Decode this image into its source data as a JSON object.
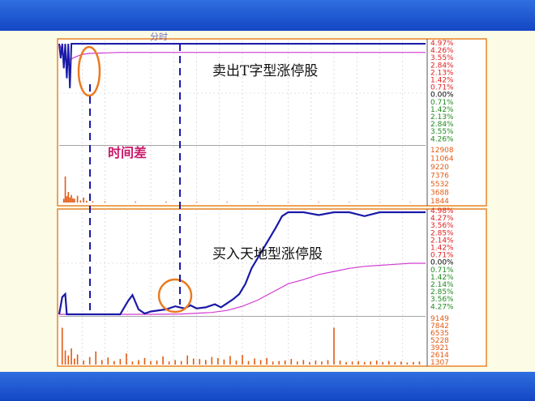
{
  "colors": {
    "price_line": "#1a1aa8",
    "avg_line": "#d23bd2",
    "volume_bar": "#e05a14",
    "up_label": "#e02020",
    "down_label": "#208a20",
    "zero_label": "#000000",
    "volume_label": "#e05a14",
    "frame": "#e8842a",
    "marker": "#ea7a20",
    "dashed": "#1a1aa8",
    "annotation": "#c8186a"
  },
  "chart_data": [
    {
      "type": "line",
      "panel": "top",
      "title": "卖出T字型涨停股",
      "header_text": "分时",
      "annotation": "时间差",
      "y_labels": [
        "4.97%",
        "4.26%",
        "3.55%",
        "2.84%",
        "2.13%",
        "1.42%",
        "0.71%",
        "0.00%",
        "0.71%",
        "1.42%",
        "2.13%",
        "2.84%",
        "3.55%",
        "4.26%"
      ],
      "y_label_signs": [
        "up",
        "up",
        "up",
        "up",
        "up",
        "up",
        "up",
        "zero",
        "down",
        "down",
        "down",
        "down",
        "down",
        "down"
      ],
      "ylim": [
        -4.97,
        4.97
      ],
      "xlim": [
        0,
        240
      ],
      "price": {
        "x": [
          0,
          1,
          2,
          3,
          4,
          5,
          6,
          7,
          8,
          9,
          10,
          11,
          12,
          15,
          20,
          40,
          60,
          90,
          120,
          150,
          180,
          210,
          240
        ],
        "y": [
          4.97,
          3.5,
          4.97,
          2.5,
          4.97,
          1.5,
          4.97,
          0.5,
          4.97,
          4.97,
          4.97,
          4.97,
          4.97,
          4.97,
          4.97,
          4.97,
          4.97,
          4.97,
          4.97,
          4.97,
          4.97,
          4.97,
          4.97
        ]
      },
      "avg": {
        "x": [
          0,
          5,
          10,
          15,
          20,
          30,
          40,
          60,
          90,
          120,
          150,
          180,
          210,
          240
        ],
        "y": [
          4.97,
          3.2,
          3.6,
          3.9,
          4.0,
          4.05,
          4.1,
          4.1,
          4.1,
          4.1,
          4.1,
          4.1,
          4.1,
          4.1
        ]
      },
      "volume_labels": [
        "12908",
        "11064",
        "9220",
        "7376",
        "5532",
        "3688",
        "1844"
      ],
      "volume_max": 12908,
      "volume": {
        "x": [
          3,
          4,
          5,
          6,
          7,
          8,
          9,
          10,
          12,
          14,
          16,
          18,
          22,
          30,
          50,
          70,
          90,
          110,
          130,
          150,
          170,
          190,
          210,
          230
        ],
        "y": [
          900,
          6200,
          1500,
          2500,
          1200,
          1800,
          1000,
          900,
          1600,
          500,
          1200,
          400,
          300,
          250,
          220,
          200,
          180,
          160,
          150,
          140,
          130,
          120,
          110,
          100
        ]
      }
    },
    {
      "type": "line",
      "panel": "bottom",
      "title": "买入天地型涨停股",
      "y_labels": [
        "4.98%",
        "4.27%",
        "3.56%",
        "2.85%",
        "2.14%",
        "1.42%",
        "0.71%",
        "0.00%",
        "0.71%",
        "1.42%",
        "2.14%",
        "2.85%",
        "3.56%",
        "4.27%"
      ],
      "y_label_signs": [
        "up",
        "up",
        "up",
        "up",
        "up",
        "up",
        "up",
        "zero",
        "down",
        "down",
        "down",
        "down",
        "down",
        "down"
      ],
      "ylim": [
        -4.98,
        4.98
      ],
      "xlim": [
        0,
        240
      ],
      "price": {
        "x": [
          0,
          2,
          4,
          5,
          8,
          14,
          20,
          30,
          40,
          45,
          48,
          52,
          56,
          60,
          70,
          76,
          82,
          86,
          90,
          96,
          102,
          106,
          110,
          114,
          118,
          122,
          126,
          130,
          134,
          138,
          142,
          146,
          150,
          155,
          160,
          170,
          180,
          190,
          200,
          210,
          220,
          230,
          240
        ],
        "y": [
          -4.98,
          -3.3,
          -3.0,
          -4.98,
          -4.98,
          -4.98,
          -4.98,
          -4.98,
          -4.98,
          -3.7,
          -3.1,
          -4.5,
          -4.9,
          -4.7,
          -4.5,
          -4.2,
          -4.4,
          -4.1,
          -4.4,
          -4.3,
          -4.0,
          -4.3,
          -3.9,
          -3.5,
          -3.0,
          -2.0,
          -0.5,
          0.5,
          1.5,
          2.5,
          3.5,
          4.6,
          4.98,
          4.98,
          4.98,
          4.7,
          4.98,
          4.98,
          4.6,
          4.98,
          4.98,
          4.98,
          4.98
        ]
      },
      "avg": {
        "x": [
          0,
          40,
          60,
          80,
          100,
          110,
          120,
          130,
          140,
          150,
          160,
          170,
          180,
          190,
          200,
          210,
          220,
          230,
          240
        ],
        "y": [
          -4.98,
          -4.98,
          -4.98,
          -4.95,
          -4.8,
          -4.6,
          -4.2,
          -3.6,
          -2.8,
          -2.0,
          -1.6,
          -1.1,
          -0.8,
          -0.5,
          -0.3,
          -0.2,
          -0.1,
          0.0,
          0.0
        ]
      },
      "volume_labels": [
        "9149",
        "7842",
        "6535",
        "5228",
        "3921",
        "2614",
        "1307"
      ],
      "volume_max": 9149,
      "volume": {
        "x": [
          2,
          4,
          6,
          8,
          10,
          12,
          16,
          20,
          24,
          28,
          32,
          36,
          40,
          44,
          48,
          52,
          56,
          60,
          64,
          68,
          72,
          76,
          80,
          84,
          88,
          92,
          96,
          100,
          104,
          108,
          112,
          116,
          120,
          124,
          128,
          132,
          136,
          140,
          144,
          148,
          152,
          156,
          160,
          164,
          168,
          172,
          176,
          180,
          184,
          188,
          192,
          196,
          200,
          204,
          208,
          212,
          216,
          220,
          224,
          228,
          232,
          236
        ],
        "y": [
          7300,
          2800,
          1800,
          3200,
          1200,
          2000,
          800,
          1500,
          2600,
          900,
          1400,
          700,
          1100,
          2200,
          600,
          900,
          1300,
          700,
          800,
          1600,
          600,
          900,
          700,
          1800,
          1200,
          1100,
          900,
          1500,
          1300,
          1000,
          1700,
          800,
          1900,
          700,
          1200,
          900,
          1300,
          600,
          700,
          800,
          1100,
          600,
          900,
          500,
          800,
          600,
          900,
          7300,
          800,
          500,
          600,
          700,
          500,
          600,
          800,
          500,
          700,
          500,
          600,
          400,
          500,
          600
        ]
      }
    }
  ]
}
